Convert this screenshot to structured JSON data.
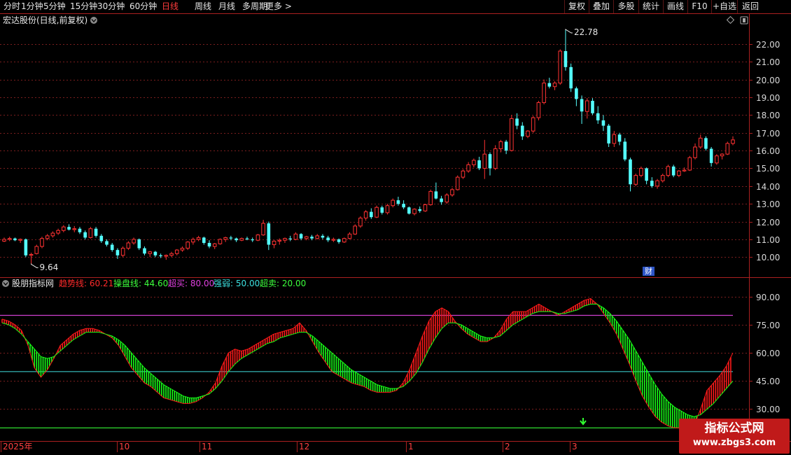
{
  "toolbar": {
    "periods": [
      "分时",
      "1分钟",
      "5分钟",
      "15分钟",
      "30分钟",
      "60分钟",
      "日线",
      "周线",
      "月线",
      "多周期",
      "更多 >"
    ],
    "active_period": "日线",
    "actions": [
      "复权",
      "叠加",
      "多股",
      "统计",
      "画线",
      "F10",
      "+自选",
      "返回"
    ]
  },
  "main_panel": {
    "title": "宏达股份(日线,前复权)",
    "price_axis_ticks": [
      "22.00",
      "21.00",
      "20.00",
      "19.00",
      "18.00",
      "17.00",
      "16.00",
      "15.00",
      "14.00",
      "13.00",
      "12.00",
      "11.00",
      "10.00"
    ],
    "high_marker": "22.78",
    "low_marker": "9.64",
    "event_badge": "财"
  },
  "indicator_panel": {
    "name": "股朋指标网",
    "readouts": [
      {
        "label": "趋势线: ",
        "value": "60.21",
        "color": "#ff2a2a"
      },
      {
        "label": "操盘线: ",
        "value": "44.60",
        "color": "#3cff3c"
      },
      {
        "label": "超买: ",
        "value": "80.00",
        "color": "#e040e0"
      },
      {
        "label": "强弱: ",
        "value": "50.00",
        "color": "#3ce0e0"
      },
      {
        "label": "超卖: ",
        "value": "20.00",
        "color": "#3cff3c"
      }
    ],
    "axis_ticks": [
      "90.00",
      "75.00",
      "60.00",
      "45.00",
      "30.00"
    ]
  },
  "time_axis": {
    "labels": [
      "2025年",
      "10",
      "11",
      "12",
      "1",
      "2",
      "3"
    ]
  },
  "watermark": {
    "title": "指标公式网",
    "url": "www.zbgs3.com"
  },
  "colors": {
    "up": "#ff3232",
    "down": "#54ffff",
    "grid": "#7a1e1e",
    "panel_border": "#aa2020",
    "overbought": "#d040d0",
    "midline": "#40e0e0",
    "oversold": "#30e030",
    "trend_up": "#ff1a1a",
    "trend_down": "#18ff18"
  },
  "chart_data": [
    {
      "type": "candlestick",
      "title": "宏达股份(日线,前复权)",
      "ylim": [
        9.5,
        22.9
      ],
      "annotations": [
        {
          "label": "22.78",
          "kind": "high"
        },
        {
          "label": "9.64",
          "kind": "low"
        }
      ],
      "ohlc": [
        [
          10.9,
          11.1,
          10.85,
          11.0
        ],
        [
          11.0,
          11.15,
          10.9,
          11.05
        ],
        [
          11.05,
          11.1,
          10.9,
          10.95
        ],
        [
          10.95,
          11.05,
          10.8,
          11.0
        ],
        [
          11.0,
          11.05,
          10.0,
          10.1
        ],
        [
          10.1,
          10.25,
          9.64,
          10.15
        ],
        [
          10.2,
          10.7,
          10.15,
          10.6
        ],
        [
          10.6,
          11.15,
          10.5,
          11.05
        ],
        [
          11.05,
          11.3,
          10.95,
          11.2
        ],
        [
          11.2,
          11.45,
          11.1,
          11.35
        ],
        [
          11.35,
          11.6,
          11.25,
          11.5
        ],
        [
          11.5,
          11.8,
          11.4,
          11.7
        ],
        [
          11.7,
          11.85,
          11.5,
          11.55
        ],
        [
          11.55,
          11.75,
          11.4,
          11.6
        ],
        [
          11.6,
          11.7,
          11.3,
          11.4
        ],
        [
          11.4,
          11.5,
          11.0,
          11.1
        ],
        [
          11.1,
          11.7,
          11.05,
          11.6
        ],
        [
          11.6,
          11.7,
          11.1,
          11.2
        ],
        [
          11.2,
          11.3,
          10.8,
          10.9
        ],
        [
          10.9,
          11.0,
          10.6,
          10.7
        ],
        [
          10.7,
          10.8,
          10.3,
          10.4
        ],
        [
          10.4,
          10.5,
          9.9,
          10.1
        ],
        [
          10.1,
          10.6,
          10.0,
          10.5
        ],
        [
          10.5,
          10.9,
          10.4,
          10.8
        ],
        [
          10.8,
          11.1,
          10.7,
          11.0
        ],
        [
          11.0,
          11.05,
          10.4,
          10.5
        ],
        [
          10.5,
          10.6,
          10.1,
          10.2
        ],
        [
          10.2,
          10.35,
          10.0,
          10.3
        ],
        [
          10.3,
          10.35,
          10.0,
          10.1
        ],
        [
          10.1,
          10.2,
          9.95,
          10.05
        ],
        [
          10.05,
          10.15,
          9.85,
          10.1
        ],
        [
          10.1,
          10.3,
          10.0,
          10.2
        ],
        [
          10.2,
          10.45,
          10.1,
          10.4
        ],
        [
          10.4,
          10.6,
          10.3,
          10.5
        ],
        [
          10.5,
          10.9,
          10.4,
          10.85
        ],
        [
          10.85,
          11.1,
          10.7,
          11.0
        ],
        [
          11.0,
          11.2,
          10.9,
          11.1
        ],
        [
          11.1,
          11.15,
          10.7,
          10.8
        ],
        [
          10.8,
          10.95,
          10.5,
          10.6
        ],
        [
          10.6,
          10.8,
          10.45,
          10.75
        ],
        [
          10.75,
          11.05,
          10.7,
          11.0
        ],
        [
          11.0,
          11.15,
          10.85,
          11.1
        ],
        [
          11.1,
          11.2,
          10.95,
          11.05
        ],
        [
          11.05,
          11.1,
          10.85,
          10.95
        ],
        [
          10.95,
          11.1,
          10.9,
          11.05
        ],
        [
          11.05,
          11.15,
          10.95,
          11.0
        ],
        [
          11.0,
          11.1,
          10.85,
          10.95
        ],
        [
          10.95,
          11.3,
          10.9,
          11.25
        ],
        [
          11.25,
          12.1,
          11.2,
          11.9
        ],
        [
          11.9,
          12.0,
          10.4,
          10.7
        ],
        [
          10.7,
          10.95,
          10.5,
          10.9
        ],
        [
          10.9,
          11.05,
          10.7,
          10.95
        ],
        [
          10.95,
          11.1,
          10.8,
          11.05
        ],
        [
          11.05,
          11.2,
          10.9,
          11.0
        ],
        [
          11.0,
          11.4,
          10.95,
          11.3
        ],
        [
          11.3,
          11.35,
          10.95,
          11.05
        ],
        [
          11.05,
          11.2,
          10.95,
          11.15
        ],
        [
          11.15,
          11.25,
          10.95,
          11.05
        ],
        [
          11.05,
          11.3,
          11.0,
          11.2
        ],
        [
          11.2,
          11.3,
          11.0,
          11.1
        ],
        [
          11.1,
          11.2,
          10.85,
          10.95
        ],
        [
          10.95,
          11.1,
          10.85,
          11.0
        ],
        [
          11.0,
          11.05,
          10.75,
          10.85
        ],
        [
          10.85,
          11.1,
          10.8,
          11.05
        ],
        [
          11.05,
          11.4,
          11.0,
          11.3
        ],
        [
          11.3,
          11.85,
          11.25,
          11.75
        ],
        [
          11.75,
          12.3,
          11.65,
          12.2
        ],
        [
          12.2,
          12.65,
          12.05,
          12.55
        ],
        [
          12.55,
          12.75,
          12.15,
          12.25
        ],
        [
          12.25,
          12.9,
          12.2,
          12.8
        ],
        [
          12.8,
          12.9,
          12.4,
          12.5
        ],
        [
          12.5,
          13.0,
          12.4,
          12.9
        ],
        [
          12.9,
          13.3,
          12.8,
          13.2
        ],
        [
          13.2,
          13.4,
          12.9,
          13.0
        ],
        [
          13.0,
          13.2,
          12.7,
          12.8
        ],
        [
          12.8,
          12.85,
          12.4,
          12.45
        ],
        [
          12.45,
          12.75,
          12.35,
          12.7
        ],
        [
          12.7,
          12.85,
          12.5,
          12.6
        ],
        [
          12.6,
          13.0,
          12.55,
          12.95
        ],
        [
          12.95,
          13.8,
          12.9,
          13.7
        ],
        [
          13.7,
          14.2,
          13.25,
          13.3
        ],
        [
          13.3,
          13.45,
          12.95,
          13.1
        ],
        [
          13.1,
          13.6,
          13.0,
          13.5
        ],
        [
          13.5,
          13.9,
          13.4,
          13.8
        ],
        [
          13.8,
          14.6,
          13.75,
          14.5
        ],
        [
          14.5,
          14.95,
          14.4,
          14.85
        ],
        [
          14.85,
          15.35,
          14.75,
          15.2
        ],
        [
          15.2,
          15.55,
          15.05,
          15.45
        ],
        [
          15.45,
          15.65,
          14.9,
          15.0
        ],
        [
          15.0,
          16.6,
          14.4,
          15.8
        ],
        [
          15.8,
          15.9,
          14.6,
          15.0
        ],
        [
          15.0,
          16.3,
          14.9,
          16.1
        ],
        [
          16.1,
          16.6,
          15.9,
          16.5
        ],
        [
          16.5,
          16.6,
          15.8,
          16.0
        ],
        [
          16.0,
          18.0,
          15.95,
          17.8
        ],
        [
          17.8,
          18.1,
          17.2,
          17.4
        ],
        [
          17.4,
          17.6,
          16.6,
          16.8
        ],
        [
          16.8,
          17.15,
          16.7,
          17.1
        ],
        [
          17.1,
          17.95,
          17.0,
          17.85
        ],
        [
          17.85,
          18.8,
          17.7,
          18.7
        ],
        [
          18.7,
          20.0,
          18.6,
          19.8
        ],
        [
          19.8,
          20.1,
          19.5,
          19.6
        ],
        [
          19.6,
          19.9,
          19.4,
          19.8
        ],
        [
          19.8,
          21.7,
          19.7,
          21.6
        ],
        [
          21.6,
          22.78,
          20.5,
          20.7
        ],
        [
          20.7,
          20.9,
          19.3,
          19.5
        ],
        [
          19.5,
          19.6,
          18.5,
          18.9
        ],
        [
          18.9,
          19.1,
          17.5,
          18.2
        ],
        [
          18.2,
          18.95,
          17.8,
          18.8
        ],
        [
          18.8,
          18.95,
          18.0,
          18.1
        ],
        [
          18.1,
          18.5,
          17.5,
          17.7
        ],
        [
          17.7,
          18.0,
          17.1,
          17.4
        ],
        [
          17.4,
          17.5,
          16.2,
          16.4
        ],
        [
          16.4,
          17.1,
          16.2,
          16.9
        ],
        [
          16.9,
          17.0,
          16.3,
          16.5
        ],
        [
          16.5,
          16.7,
          15.4,
          15.5
        ],
        [
          15.5,
          15.6,
          13.7,
          14.1
        ],
        [
          14.1,
          14.7,
          14.0,
          14.6
        ],
        [
          14.6,
          15.1,
          14.5,
          15.0
        ],
        [
          15.0,
          15.05,
          14.1,
          14.3
        ],
        [
          14.3,
          14.5,
          13.9,
          14.0
        ],
        [
          14.0,
          14.4,
          13.85,
          14.3
        ],
        [
          14.3,
          14.7,
          14.2,
          14.6
        ],
        [
          14.6,
          15.2,
          14.5,
          15.1
        ],
        [
          15.1,
          15.2,
          14.5,
          14.6
        ],
        [
          14.6,
          14.9,
          14.5,
          14.85
        ],
        [
          14.85,
          15.05,
          14.8,
          14.9
        ],
        [
          14.9,
          15.7,
          14.85,
          15.6
        ],
        [
          15.6,
          16.4,
          15.5,
          16.2
        ],
        [
          16.2,
          16.9,
          16.1,
          16.7
        ],
        [
          16.7,
          16.8,
          16.0,
          16.1
        ],
        [
          16.1,
          16.2,
          15.1,
          15.3
        ],
        [
          15.3,
          15.8,
          15.2,
          15.7
        ],
        [
          15.7,
          15.85,
          15.5,
          15.8
        ],
        [
          15.8,
          16.5,
          15.75,
          16.4
        ],
        [
          16.4,
          16.8,
          16.3,
          16.6
        ]
      ]
    },
    {
      "type": "area",
      "title": "股朋指标网",
      "ylim": [
        13,
        97
      ],
      "reference_lines": {
        "overbought": 80,
        "midline": 50,
        "oversold": 20
      },
      "series": [
        {
          "name": "趋势线",
          "values": [
            78,
            77,
            75,
            72,
            64,
            52,
            47,
            51,
            57,
            64,
            67,
            70,
            72,
            73,
            73,
            72,
            70,
            68,
            64,
            58,
            52,
            48,
            44,
            42,
            39,
            36,
            35,
            34,
            33,
            33,
            34,
            36,
            39,
            44,
            53,
            60,
            62,
            61,
            62,
            64,
            66,
            68,
            70,
            71,
            72,
            73,
            76,
            72,
            66,
            60,
            55,
            50,
            48,
            46,
            44,
            43,
            42,
            40,
            39,
            39,
            39,
            40,
            44,
            51,
            60,
            69,
            77,
            82,
            84,
            82,
            77,
            73,
            70,
            68,
            66,
            66,
            68,
            72,
            78,
            82,
            82,
            82,
            84,
            86,
            84,
            82,
            80,
            82,
            84,
            86,
            88,
            89,
            86,
            81,
            76,
            70,
            62,
            54,
            45,
            37,
            31,
            26,
            23,
            21,
            20,
            20,
            20,
            21,
            30,
            40,
            44,
            48,
            53,
            60
          ]
        },
        {
          "name": "操盘线",
          "values": [
            76,
            75,
            73,
            70,
            66,
            62,
            58,
            57,
            58,
            61,
            64,
            67,
            69,
            71,
            71,
            71,
            70,
            69,
            67,
            64,
            60,
            56,
            52,
            49,
            46,
            43,
            41,
            39,
            37,
            36,
            36,
            37,
            38,
            41,
            45,
            50,
            54,
            57,
            59,
            61,
            63,
            65,
            66,
            68,
            69,
            70,
            71,
            71,
            69,
            66,
            63,
            60,
            57,
            54,
            51,
            49,
            47,
            45,
            43,
            42,
            41,
            41,
            42,
            45,
            49,
            55,
            62,
            68,
            73,
            76,
            76,
            75,
            73,
            71,
            69,
            68,
            68,
            69,
            72,
            75,
            77,
            79,
            81,
            82,
            82,
            82,
            81,
            81,
            82,
            83,
            85,
            86,
            86,
            84,
            81,
            77,
            72,
            67,
            61,
            55,
            49,
            43,
            38,
            34,
            31,
            29,
            27,
            26,
            27,
            30,
            33,
            37,
            41,
            45
          ]
        }
      ]
    }
  ]
}
